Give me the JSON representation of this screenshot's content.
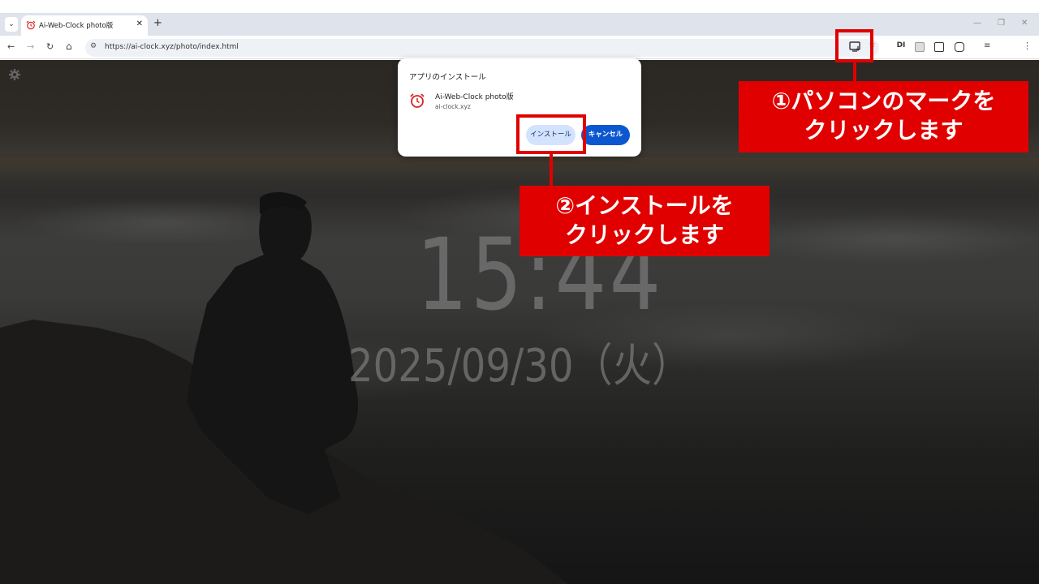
{
  "browser": {
    "tab_title": "Ai-Web-Clock photo版",
    "tab_close": "✕",
    "tab_list": "⌄",
    "new_tab": "+",
    "url": "https://ai-clock.xyz/photo/index.html",
    "minimize": "—",
    "restore": "❐",
    "close": "✕",
    "back": "←",
    "forward": "→",
    "reload": "↻",
    "home": "⌂",
    "site_info": "⚙",
    "star": "☆",
    "menu": "⋮",
    "extensions": [
      "DI",
      "",
      "",
      ""
    ]
  },
  "popup": {
    "title": "アプリのインストール",
    "app_name": "Ai-Web-Clock photo版",
    "app_domain": "ai-clock.xyz",
    "install_label": "インストール",
    "cancel_label": "キャンセル"
  },
  "clock": {
    "time": "15:44",
    "date": "2025/09/30（火）"
  },
  "annotations": {
    "step1_line1": "①パソコンのマークを",
    "step1_line2": "クリックします",
    "step2_line1": "②インストールを",
    "step2_line2": "クリックします",
    "highlight_color": "#e00000"
  }
}
